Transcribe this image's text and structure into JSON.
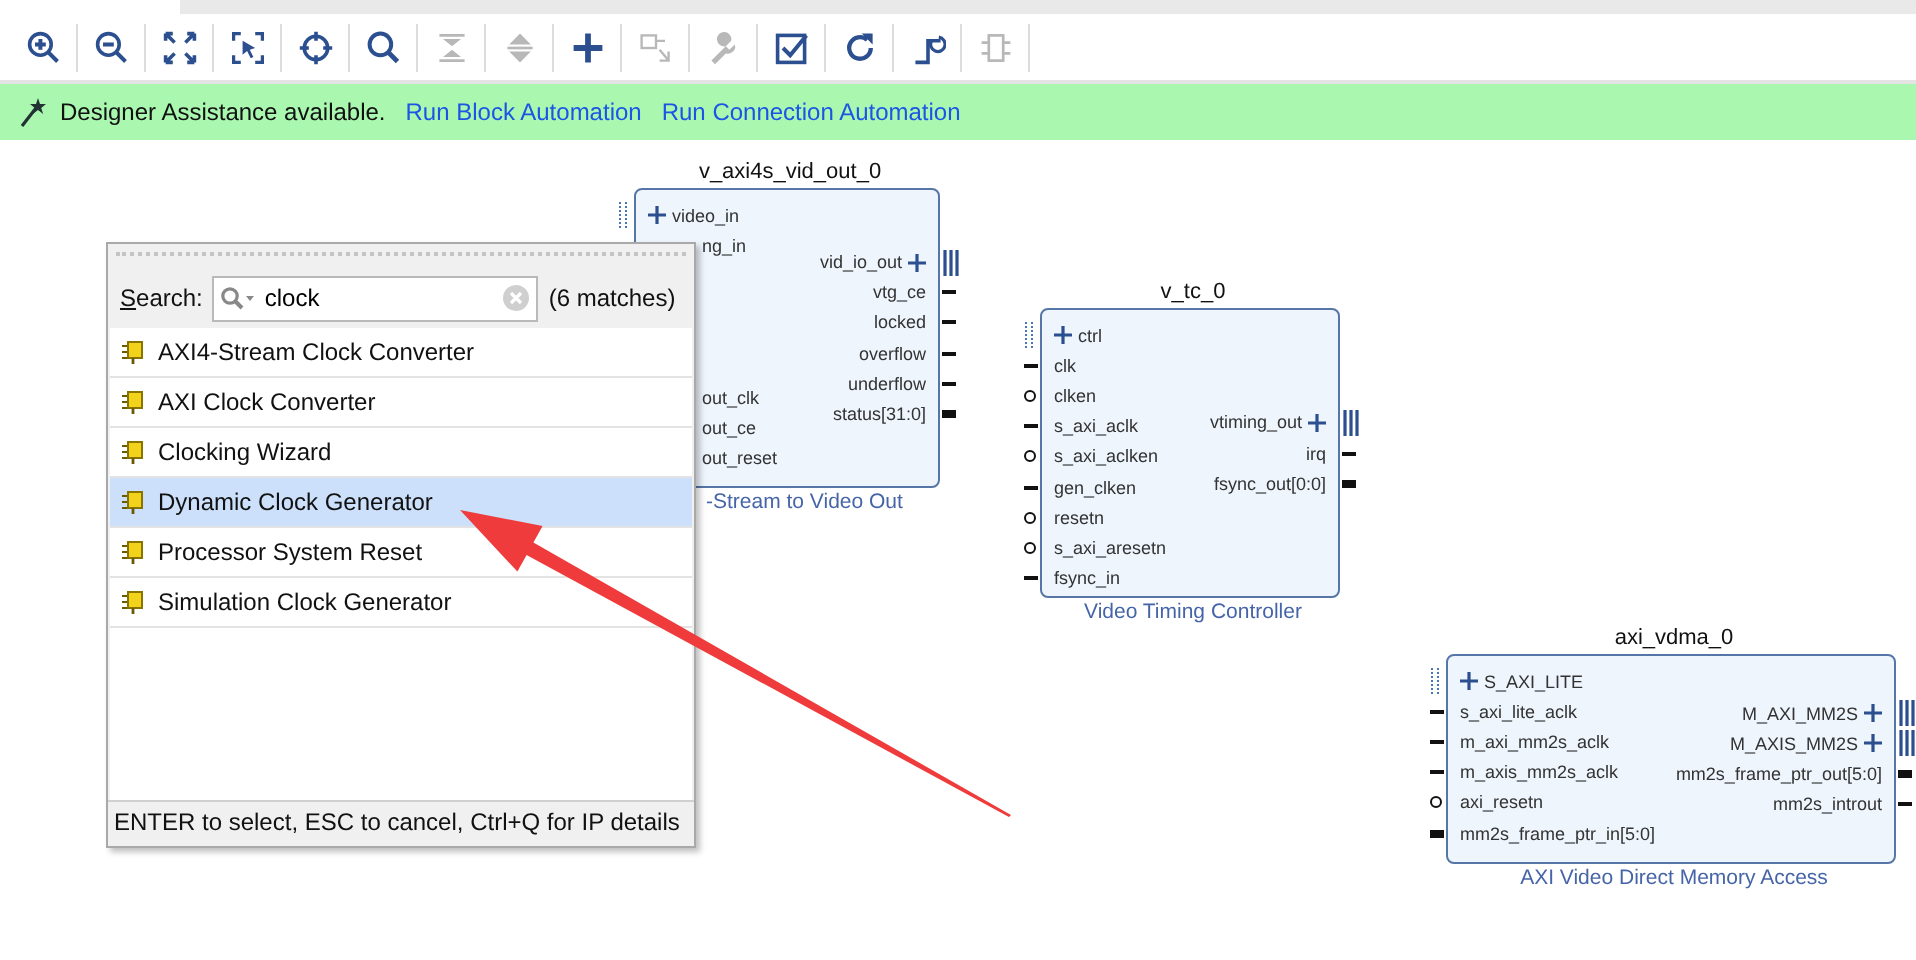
{
  "toolbar": {
    "tools": [
      {
        "kind": "zoom-in",
        "disabled": false
      },
      {
        "kind": "zoom-out",
        "disabled": false
      },
      {
        "kind": "fit",
        "disabled": false
      },
      {
        "kind": "select-area",
        "disabled": false
      },
      {
        "kind": "crosshair",
        "disabled": false
      },
      {
        "kind": "search",
        "disabled": false
      },
      {
        "kind": "collapse",
        "disabled": true
      },
      {
        "kind": "expand",
        "disabled": true
      },
      {
        "kind": "add",
        "disabled": false
      },
      {
        "kind": "connect",
        "disabled": true
      },
      {
        "kind": "wrench",
        "disabled": true
      },
      {
        "kind": "validate",
        "disabled": false
      },
      {
        "kind": "refresh",
        "disabled": false
      },
      {
        "kind": "regenerate",
        "disabled": false
      },
      {
        "kind": "hierarchy",
        "disabled": true
      }
    ]
  },
  "assistance": {
    "message": "Designer Assistance available.",
    "links": [
      "Run Block Automation",
      "Run Connection Automation"
    ]
  },
  "blocks": [
    {
      "name": "v_axi4s_vid_out_0",
      "subtitle": "-Stream to Video Out",
      "left_ports": [
        {
          "label": "video_in",
          "kind": "interface"
        },
        {
          "label": "ng_in",
          "kind": "covered"
        },
        {
          "kind": "blank"
        },
        {
          "kind": "blank"
        },
        {
          "kind": "blank"
        },
        {
          "kind": "blank"
        },
        {
          "label": "out_clk",
          "kind": "covered"
        },
        {
          "label": "out_ce",
          "kind": "covered"
        },
        {
          "label": "out_reset",
          "kind": "covered"
        }
      ],
      "right_ports": [
        {
          "label": "vid_io_out",
          "kind": "interface"
        },
        {
          "label": "vtg_ce",
          "kind": "wire"
        },
        {
          "label": "locked",
          "kind": "wire"
        },
        {
          "label": "overflow",
          "kind": "wire"
        },
        {
          "label": "underflow",
          "kind": "wire"
        },
        {
          "label": "status[31:0]",
          "kind": "bus"
        }
      ]
    },
    {
      "name": "v_tc_0",
      "subtitle": "Video Timing Controller",
      "left_ports": [
        {
          "label": "ctrl",
          "kind": "interface"
        },
        {
          "label": "clk",
          "kind": "wire"
        },
        {
          "label": "clken",
          "kind": "inverted"
        },
        {
          "label": "s_axi_aclk",
          "kind": "wire"
        },
        {
          "label": "s_axi_aclken",
          "kind": "inverted"
        },
        {
          "label": "gen_clken",
          "kind": "wire"
        },
        {
          "label": "resetn",
          "kind": "inverted"
        },
        {
          "label": "s_axi_aresetn",
          "kind": "inverted"
        },
        {
          "label": "fsync_in",
          "kind": "wire"
        }
      ],
      "right_ports": [
        {
          "label": "vtiming_out",
          "kind": "interface"
        },
        {
          "label": "irq",
          "kind": "wire"
        },
        {
          "label": "fsync_out[0:0]",
          "kind": "bus"
        }
      ]
    },
    {
      "name": "axi_vdma_0",
      "subtitle": "AXI Video Direct Memory Access",
      "left_ports": [
        {
          "label": "S_AXI_LITE",
          "kind": "interface"
        },
        {
          "label": "s_axi_lite_aclk",
          "kind": "wire"
        },
        {
          "label": "m_axi_mm2s_aclk",
          "kind": "wire"
        },
        {
          "label": "m_axis_mm2s_aclk",
          "kind": "wire"
        },
        {
          "label": "axi_resetn",
          "kind": "inverted"
        },
        {
          "label": "mm2s_frame_ptr_in[5:0]",
          "kind": "bus"
        }
      ],
      "right_ports": [
        {
          "label": "M_AXI_MM2S",
          "kind": "interface"
        },
        {
          "label": "M_AXIS_MM2S",
          "kind": "interface"
        },
        {
          "label": "mm2s_frame_ptr_out[5:0]",
          "kind": "bus"
        },
        {
          "label": "mm2s_introut",
          "kind": "wire"
        }
      ]
    }
  ],
  "ip_search": {
    "label": "Search:",
    "value": "clock",
    "match_count": "(6 matches)",
    "results": [
      {
        "label": "AXI4-Stream Clock Converter",
        "selected": false
      },
      {
        "label": "AXI Clock Converter",
        "selected": false
      },
      {
        "label": "Clocking Wizard",
        "selected": false
      },
      {
        "label": "Dynamic Clock Generator",
        "selected": true
      },
      {
        "label": "Processor System Reset",
        "selected": false
      },
      {
        "label": "Simulation Clock Generator",
        "selected": false
      }
    ],
    "hint": "ENTER to select, ESC to cancel, Ctrl+Q for IP details"
  }
}
